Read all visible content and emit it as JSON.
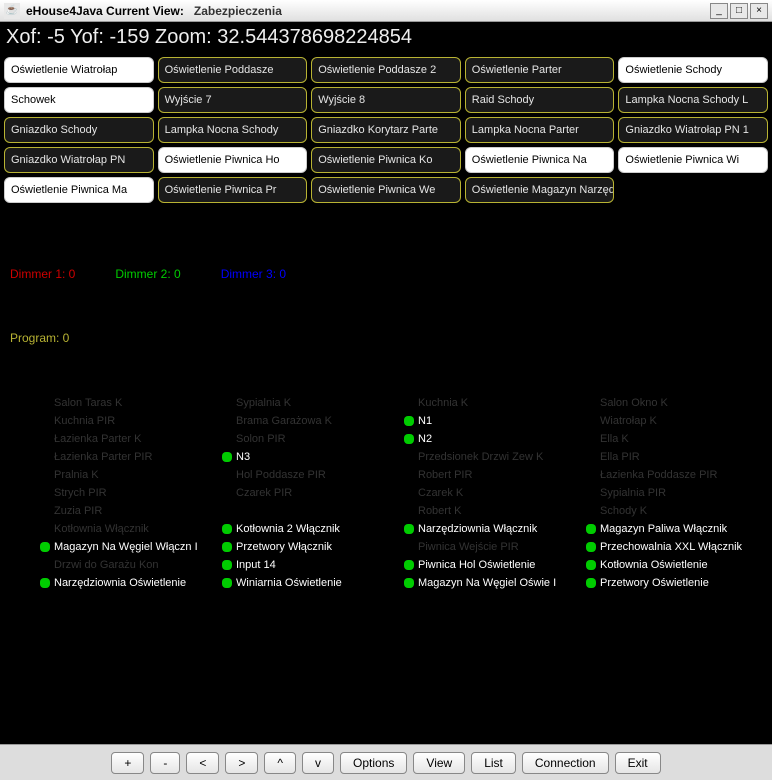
{
  "window": {
    "app_title": "eHouse4Java Current View:",
    "view_name": "Zabezpieczenia"
  },
  "coords": {
    "xof_label": "Xof:",
    "xof": "-5",
    "yof_label": "Yof:",
    "yof": "-159",
    "zoom_label": "Zoom:",
    "zoom": "32.544378698224854"
  },
  "tiles": [
    {
      "text": "Oświetlenie Wiatrołap",
      "style": "white"
    },
    {
      "text": "Oświetlenie Poddasze",
      "style": "dark"
    },
    {
      "text": "Oświetlenie Poddasze 2",
      "style": "dark"
    },
    {
      "text": "Oświetlenie Parter",
      "style": "dark"
    },
    {
      "text": "Oświetlenie Schody",
      "style": "white"
    },
    {
      "text": "Schowek",
      "style": "white"
    },
    {
      "text": "Wyjście 7",
      "style": "dark"
    },
    {
      "text": "Wyjście 8",
      "style": "dark"
    },
    {
      "text": "Raid Schody",
      "style": "dark"
    },
    {
      "text": "Lampka Nocna Schody L",
      "style": "dark"
    },
    {
      "text": "Gniazdko Schody",
      "style": "dark"
    },
    {
      "text": "Lampka Nocna Schody",
      "style": "dark"
    },
    {
      "text": "Gniazdko Korytarz Parte",
      "style": "dark"
    },
    {
      "text": "Lampka Nocna Parter",
      "style": "dark"
    },
    {
      "text": "Gniazdko Wiatrołap PN 1",
      "style": "dark"
    },
    {
      "text": "Gniazdko Wiatrołap PN",
      "style": "dark"
    },
    {
      "text": "Oświetlenie Piwnica Ho",
      "style": "white"
    },
    {
      "text": "Oświetlenie Piwnica Ko",
      "style": "dark"
    },
    {
      "text": "Oświetlenie Piwnica Na",
      "style": "white"
    },
    {
      "text": "Oświetlenie Piwnica Wi",
      "style": "white"
    },
    {
      "text": "Oświetlenie Piwnica Ma",
      "style": "white"
    },
    {
      "text": "Oświetlenie Piwnica Pr",
      "style": "dark"
    },
    {
      "text": "Oświetlenie Piwnica We",
      "style": "dark"
    },
    {
      "text": "Oświetlenie Magazyn Narzędzia",
      "style": "dark"
    }
  ],
  "dimmers": {
    "d1": "Dimmer 1: 0",
    "d2": "Dimmer 2: 0",
    "d3": "Dimmer 3: 0"
  },
  "program": "Program: 0",
  "sensors": [
    [
      {
        "dot": "none",
        "label": "Salon Taras K",
        "dim": true
      },
      {
        "dot": "none",
        "label": "Kuchnia PIR",
        "dim": true
      },
      {
        "dot": "none",
        "label": "Łazienka Parter K",
        "dim": true
      },
      {
        "dot": "none",
        "label": "Łazienka Parter PIR",
        "dim": true
      },
      {
        "dot": "none",
        "label": "Pralnia K",
        "dim": true
      },
      {
        "dot": "none",
        "label": "Strych PIR",
        "dim": true
      },
      {
        "dot": "none",
        "label": "Zuzia PIR",
        "dim": true
      },
      {
        "dot": "none",
        "label": "Kotłownia Włącznik",
        "dim": true
      },
      {
        "dot": "green",
        "label": "Magazyn Na Węgiel Włączn  I",
        "dim": false
      },
      {
        "dot": "none",
        "label": "Drzwi do Garażu Kon",
        "dim": true
      },
      {
        "dot": "green",
        "label": "Narzędziownia Oświetlenie",
        "dim": false
      }
    ],
    [
      {
        "dot": "none",
        "label": "Sypialnia K",
        "dim": true
      },
      {
        "dot": "none",
        "label": "Brama Garażowa K",
        "dim": true
      },
      {
        "dot": "none",
        "label": "Solon PIR",
        "dim": true
      },
      {
        "dot": "green",
        "label": "N3",
        "dim": false
      },
      {
        "dot": "none",
        "label": "Hol Poddasze PIR",
        "dim": true
      },
      {
        "dot": "none",
        "label": "Czarek PIR",
        "dim": true
      },
      {
        "dot": "none",
        "label": "",
        "dim": true
      },
      {
        "dot": "green",
        "label": "Kotłownia 2 Włącznik",
        "dim": false
      },
      {
        "dot": "green",
        "label": "Przetwory Włącznik",
        "dim": false
      },
      {
        "dot": "green",
        "label": "Input 14",
        "dim": false
      },
      {
        "dot": "green",
        "label": "Winiarnia Oświetlenie",
        "dim": false
      }
    ],
    [
      {
        "dot": "none",
        "label": "Kuchnia K",
        "dim": true
      },
      {
        "dot": "green",
        "label": "N1",
        "dim": false
      },
      {
        "dot": "green",
        "label": "N2",
        "dim": false
      },
      {
        "dot": "none",
        "label": "Przedsionek Drzwi Zew K",
        "dim": true
      },
      {
        "dot": "none",
        "label": "Robert PIR",
        "dim": true
      },
      {
        "dot": "none",
        "label": "Czarek K",
        "dim": true
      },
      {
        "dot": "none",
        "label": "Robert K",
        "dim": true
      },
      {
        "dot": "green",
        "label": "Narzędziownia Włącznik",
        "dim": false
      },
      {
        "dot": "none",
        "label": "Piwnica Wejście PIR",
        "dim": true
      },
      {
        "dot": "green",
        "label": "Piwnica Hol Oświetlenie",
        "dim": false
      },
      {
        "dot": "green",
        "label": "Magazyn Na Węgiel Oświe  I",
        "dim": false
      }
    ],
    [
      {
        "dot": "none",
        "label": "Salon Okno K",
        "dim": true
      },
      {
        "dot": "none",
        "label": "Wiatrołap K",
        "dim": true
      },
      {
        "dot": "none",
        "label": "Ella K",
        "dim": true
      },
      {
        "dot": "none",
        "label": "Ella PIR",
        "dim": true
      },
      {
        "dot": "none",
        "label": "Łazienka Poddasze PIR",
        "dim": true
      },
      {
        "dot": "none",
        "label": "Sypialnia PIR",
        "dim": true
      },
      {
        "dot": "none",
        "label": "Schody K",
        "dim": true
      },
      {
        "dot": "green",
        "label": "Magazyn Paliwa Włącznik",
        "dim": false
      },
      {
        "dot": "green",
        "label": "Przechowalnia XXL Włącznik",
        "dim": false
      },
      {
        "dot": "green",
        "label": "Kotłownia Oświetlenie",
        "dim": false
      },
      {
        "dot": "green",
        "label": "Przetwory Oświetlenie",
        "dim": false
      }
    ]
  ],
  "toolbar": {
    "plus": "+",
    "minus": "-",
    "left": "<",
    "right": ">",
    "up": "^",
    "down": "v",
    "options": "Options",
    "view": "View",
    "list": "List",
    "connection": "Connection",
    "exit": "Exit"
  }
}
